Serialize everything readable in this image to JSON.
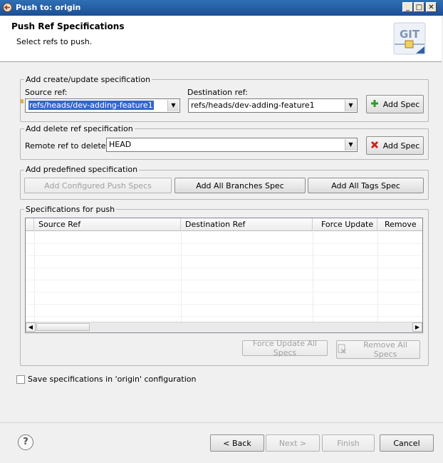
{
  "window": {
    "title": "Push to: origin"
  },
  "header": {
    "title": "Push Ref Specifications",
    "description": "Select refs to push.",
    "logo_text": "GIT"
  },
  "create_update": {
    "legend": "Add create/update specification",
    "source_label": "Source ref:",
    "source_value": "refs/heads/dev-adding-feature1",
    "dest_label": "Destination ref:",
    "dest_value": "refs/heads/dev-adding-feature1",
    "add_button": "Add Spec"
  },
  "delete_ref": {
    "legend": "Add delete ref specification",
    "remote_label": "Remote ref to delete:",
    "remote_value": "HEAD",
    "add_button": "Add Spec"
  },
  "predefined": {
    "legend": "Add predefined specification",
    "configured_button": "Add Configured Push Specs",
    "branches_button": "Add All Branches Spec",
    "tags_button": "Add All Tags Spec"
  },
  "specs": {
    "legend": "Specifications for push",
    "columns": [
      "Source Ref",
      "Destination Ref",
      "Force Update",
      "Remove"
    ],
    "rows": [],
    "force_update_all": "Force Update All Specs",
    "remove_all": "Remove All Specs"
  },
  "save_config": {
    "label": "Save specifications in 'origin' configuration",
    "checked": false
  },
  "footer": {
    "back": "< Back",
    "next": "Next >",
    "finish": "Finish",
    "cancel": "Cancel"
  }
}
